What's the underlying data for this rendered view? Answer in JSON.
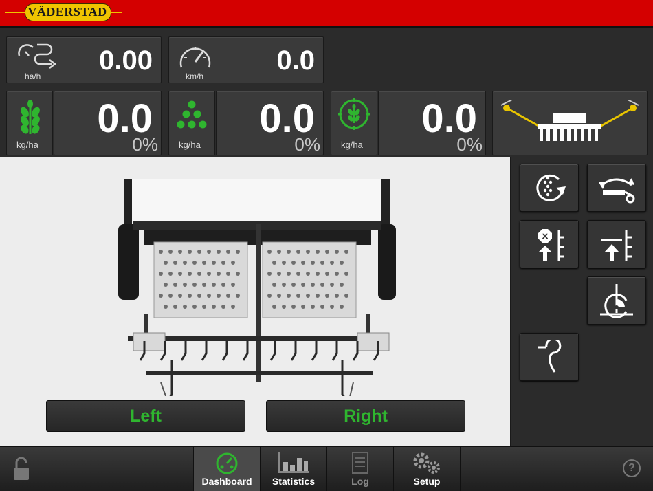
{
  "brand": {
    "logo_text": "VÄDERSTAD"
  },
  "metrics": {
    "area_rate": {
      "value": "0.00",
      "unit": "ha/h"
    },
    "speed": {
      "value": "0.0",
      "unit": "km/h"
    }
  },
  "hoppers": [
    {
      "icon": "wheat-icon",
      "unit": "kg/ha",
      "value": "0.0",
      "percent": "0%",
      "color": "#2fb52f"
    },
    {
      "icon": "seeds-icon",
      "unit": "kg/ha",
      "value": "0.0",
      "percent": "0%",
      "color": "#2fb52f"
    },
    {
      "icon": "wheat-target-icon",
      "unit": "kg/ha",
      "value": "0.0",
      "percent": "0%",
      "color": "#2fb52f"
    }
  ],
  "buttons": {
    "left": "Left",
    "right": "Right"
  },
  "nav": {
    "tabs": [
      {
        "label": "Dashboard",
        "active": true
      },
      {
        "label": "Statistics",
        "active": false
      },
      {
        "label": "Log",
        "active": false,
        "disabled": true
      },
      {
        "label": "Setup",
        "active": false
      }
    ]
  },
  "colors": {
    "accent_green": "#2fb52f",
    "header_red": "#d40000",
    "logo_yellow": "#f0c400",
    "marker_yellow": "#e8c400"
  }
}
